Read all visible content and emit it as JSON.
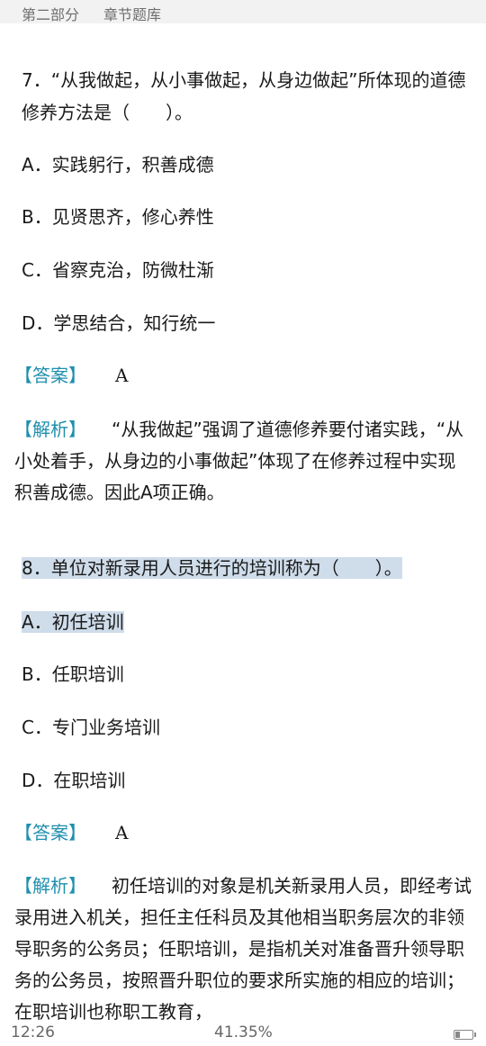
{
  "header": {
    "part": "第二部分",
    "chapter": "章节题库"
  },
  "questions": [
    {
      "stem": "7．“从我做起，从小事做起，从身边做起”所体现的道德修养方法是（　　）。",
      "options": [
        "A．实践躬行，积善成德",
        "B．见贤思齐，修心养性",
        "C．省察克治，防微杜渐",
        "D．学思结合，知行统一"
      ],
      "answer_label": "【答案】",
      "answer": "A",
      "analysis_label": "【解析】",
      "analysis": "“从我做起”强调了道德修养要付诸实践，“从小处着手，从身边的小事做起”体现了在修养过程中实现积善成德。因此A项正确。"
    },
    {
      "stem": "8．单位对新录用人员进行的培训称为（　　）。",
      "options": [
        "A．初任培训",
        "B．任职培训",
        "C．专门业务培训",
        "D．在职培训"
      ],
      "answer_label": "【答案】",
      "answer": "A",
      "analysis_label": "【解析】",
      "analysis": "初任培训的对象是机关新录用人员，即经考试录用进入机关，担任主任科员及其他相当职务层次的非领导职务的公务员；任职培训，是指机关对准备晋升领导职务的公务员，按照晋升职位的要求所实施的相应的培训；在职培训也称职工教育，"
    }
  ],
  "status": {
    "time": "12:26",
    "progress": "41.35%",
    "battery_icon": "battery-icon"
  },
  "colors": {
    "bracket": "#1f8fae",
    "highlight": "#cfdcea"
  }
}
